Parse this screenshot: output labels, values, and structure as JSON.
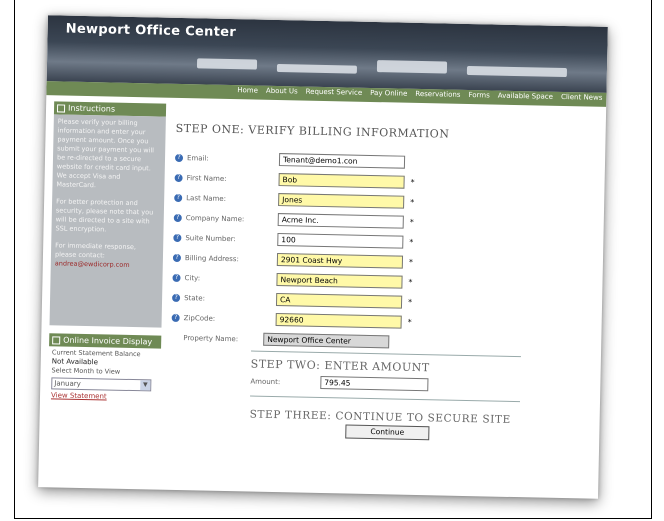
{
  "site": {
    "logo": "Newport Office Center"
  },
  "nav": {
    "items": [
      "Home",
      "About Us",
      "Request Service",
      "Pay Online",
      "Reservations",
      "Forms",
      "Available Space",
      "Client News"
    ]
  },
  "instructions": {
    "title": "Instructions",
    "p1": "Please verify your billing information and enter your payment amount. Once you submit your payment you will be re-directed to a secure website for credit card input. We accept Visa and MasterCard.",
    "p2": "For better protection and security, please note that you will be directed to a site with SSL encryption.",
    "p3": "For immediate response, please contact:",
    "email": "andrea@ewdicorp.com"
  },
  "invoice": {
    "title": "Online Invoice Display",
    "label1": "Current Statement Balance",
    "value1": "Not Available",
    "label2": "Select Month to View",
    "month": "January",
    "link": "View Statement"
  },
  "step1": {
    "title": "STEP ONE: VERIFY BILLING INFORMATION"
  },
  "fields": [
    {
      "label": "Email:",
      "value": "Tenant@demo1.con",
      "required": false
    },
    {
      "label": "First Name:",
      "value": "Bob",
      "required": true
    },
    {
      "label": "Last Name:",
      "value": "Jones",
      "required": true
    },
    {
      "label": "Company Name:",
      "value": "Acme Inc.",
      "required": true
    },
    {
      "label": "Suite Number:",
      "value": "100",
      "required": true
    },
    {
      "label": "Billing Address:",
      "value": "2901 Coast Hwy",
      "required": true
    },
    {
      "label": "City:",
      "value": "Newport Beach",
      "required": true
    },
    {
      "label": "State:",
      "value": "CA",
      "required": true
    },
    {
      "label": "ZipCode:",
      "value": "92660",
      "required": true
    }
  ],
  "property": {
    "label": "Property Name:",
    "value": "Newport Office Center"
  },
  "step2": {
    "title": "STEP TWO: ENTER AMOUNT",
    "amount_label": "Amount:",
    "amount": "795.45"
  },
  "step3": {
    "title": "STEP THREE: CONTINUE TO SECURE SITE",
    "button": "Continue"
  },
  "required_mark": "*"
}
